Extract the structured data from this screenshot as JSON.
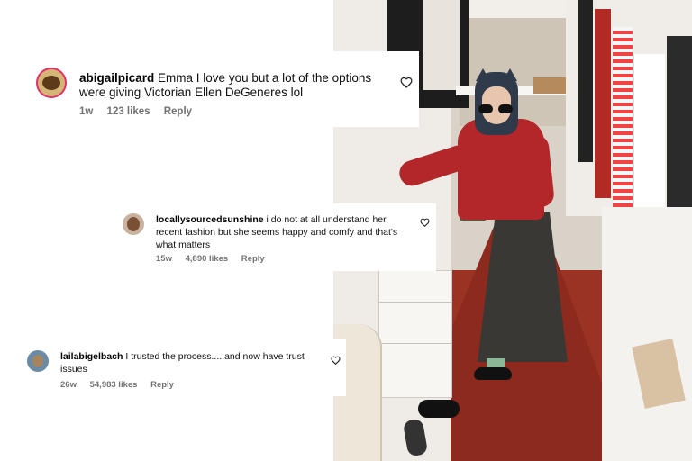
{
  "comments": [
    {
      "username": "abigailpicard",
      "text": "Emma I love you but a lot of the options were giving Victorian Ellen DeGeneres lol",
      "age": "1w",
      "likes": "123 likes",
      "reply": "Reply",
      "heart_icon": "heart-outline-icon"
    },
    {
      "username": "locallysourcedsunshine",
      "text": "i do not at all understand her recent fashion but she seems happy and comfy and that's what matters",
      "age": "15w",
      "likes": "4,890 likes",
      "reply": "Reply",
      "heart_icon": "heart-outline-icon"
    },
    {
      "username": "lailabigelbach",
      "text": "I trusted the process.....and now have trust issues",
      "age": "26w",
      "likes": "54,983 likes",
      "reply": "Reply",
      "heart_icon": "heart-outline-icon"
    }
  ],
  "colors": {
    "username": "#000000",
    "meta": "#737373",
    "story_ring": "#e1306c",
    "sweater": "#b3262a",
    "carpet": "#9a3324"
  }
}
